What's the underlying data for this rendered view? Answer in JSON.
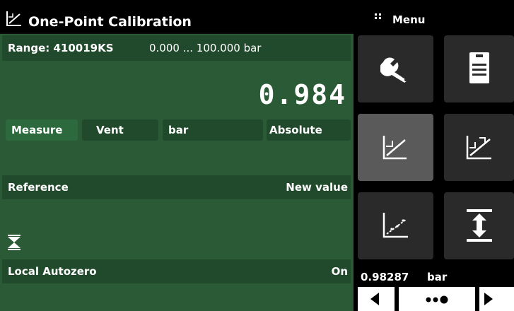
{
  "title": "One-Point Calibration",
  "range": {
    "label": "Range: 410019KS",
    "span": "0.000 ... 100.000 bar"
  },
  "reading": {
    "value": "0.984"
  },
  "modes": {
    "measure": "Measure",
    "vent": "Vent",
    "unit": "bar",
    "type": "Absolute"
  },
  "reference": {
    "label": "Reference",
    "value": "New value"
  },
  "autozero": {
    "label": "Local Autozero",
    "value": "On"
  },
  "menu": {
    "label": "Menu",
    "tiles": [
      {
        "icon": "wrench-icon"
      },
      {
        "icon": "document-icon"
      },
      {
        "icon": "one-point-calibration-icon",
        "active": true
      },
      {
        "icon": "two-point-calibration-icon"
      },
      {
        "icon": "linearization-icon"
      },
      {
        "icon": "span-adjust-icon"
      }
    ]
  },
  "status": {
    "value": "0.98287",
    "unit": "bar"
  },
  "colors": {
    "panel": "#2b5a36",
    "row": "#21492c",
    "tile": "#2a2a2a",
    "active_tile": "#5a5a5a"
  }
}
